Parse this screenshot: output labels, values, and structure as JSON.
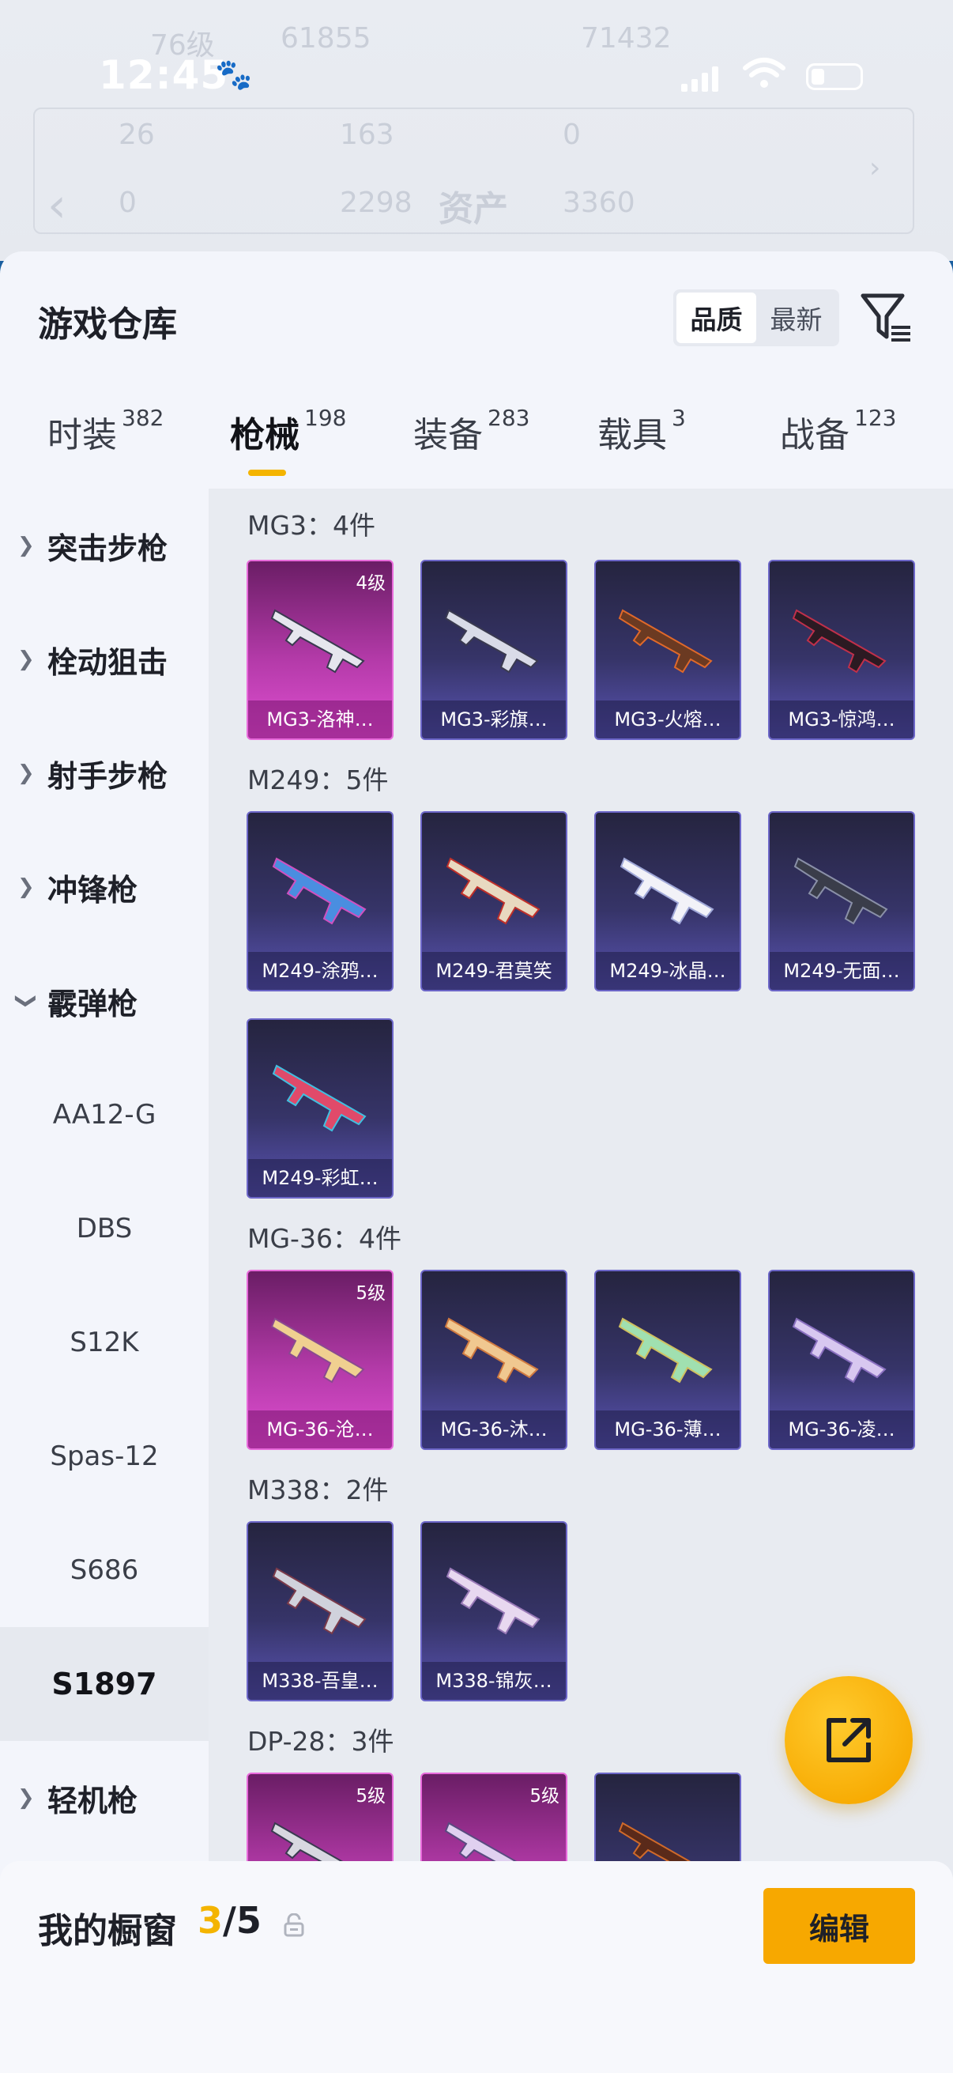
{
  "status_bar": {
    "time": "12:45"
  },
  "background_header": {
    "row1": [
      "76级",
      "61855",
      "71432"
    ],
    "row2": [
      "26",
      "163",
      "0"
    ],
    "row3": [
      "0",
      "2298",
      "3360"
    ],
    "title": "资产"
  },
  "sheet": {
    "title": "游戏仓库"
  },
  "sort": {
    "options": [
      "品质",
      "最新"
    ],
    "active": "品质"
  },
  "tabs": [
    {
      "label": "时装",
      "count": "382"
    },
    {
      "label": "枪械",
      "count": "198"
    },
    {
      "label": "装备",
      "count": "283"
    },
    {
      "label": "载具",
      "count": "3"
    },
    {
      "label": "战备",
      "count": "123"
    }
  ],
  "categories": {
    "assault": "突击步枪",
    "sniper": "栓动狙击",
    "marksman": "射手步枪",
    "smg": "冲锋枪",
    "shotgun": "霰弹枪",
    "shotgun_items": [
      "AA12-G",
      "DBS",
      "S12K",
      "Spas-12",
      "S686",
      "S1897"
    ],
    "lmg": "轻机枪"
  },
  "groups": [
    {
      "title": "MG3：4件",
      "items": [
        {
          "name": "MG3-洛神…",
          "level": "4级"
        },
        {
          "name": "MG3-彩旗…"
        },
        {
          "name": "MG3-火熔…"
        },
        {
          "name": "MG3-惊鸿…"
        }
      ]
    },
    {
      "title": "M249：5件",
      "items": [
        {
          "name": "M249-涂鸦…"
        },
        {
          "name": "M249-君莫笑"
        },
        {
          "name": "M249-冰晶…"
        },
        {
          "name": "M249-无面…"
        },
        {
          "name": "M249-彩虹…"
        }
      ]
    },
    {
      "title": "MG-36：4件",
      "items": [
        {
          "name": "MG-36-沧…",
          "level": "5级"
        },
        {
          "name": "MG-36-沐…"
        },
        {
          "name": "MG-36-薄…"
        },
        {
          "name": "MG-36-凌…"
        }
      ]
    },
    {
      "title": "M338：2件",
      "items": [
        {
          "name": "M338-吾皇…"
        },
        {
          "name": "M338-锦灰…"
        }
      ]
    },
    {
      "title": "DP-28：3件",
      "items": [
        {
          "level": "5级"
        },
        {
          "level": "5级"
        },
        {}
      ]
    }
  ],
  "showcase": {
    "title": "我的橱窗",
    "current": "3",
    "total": "/5",
    "edit_label": "编辑"
  },
  "colors": {
    "accent": "#f7a800",
    "rare_card": "#e04fd2",
    "epic_card": "#5a54b4"
  }
}
